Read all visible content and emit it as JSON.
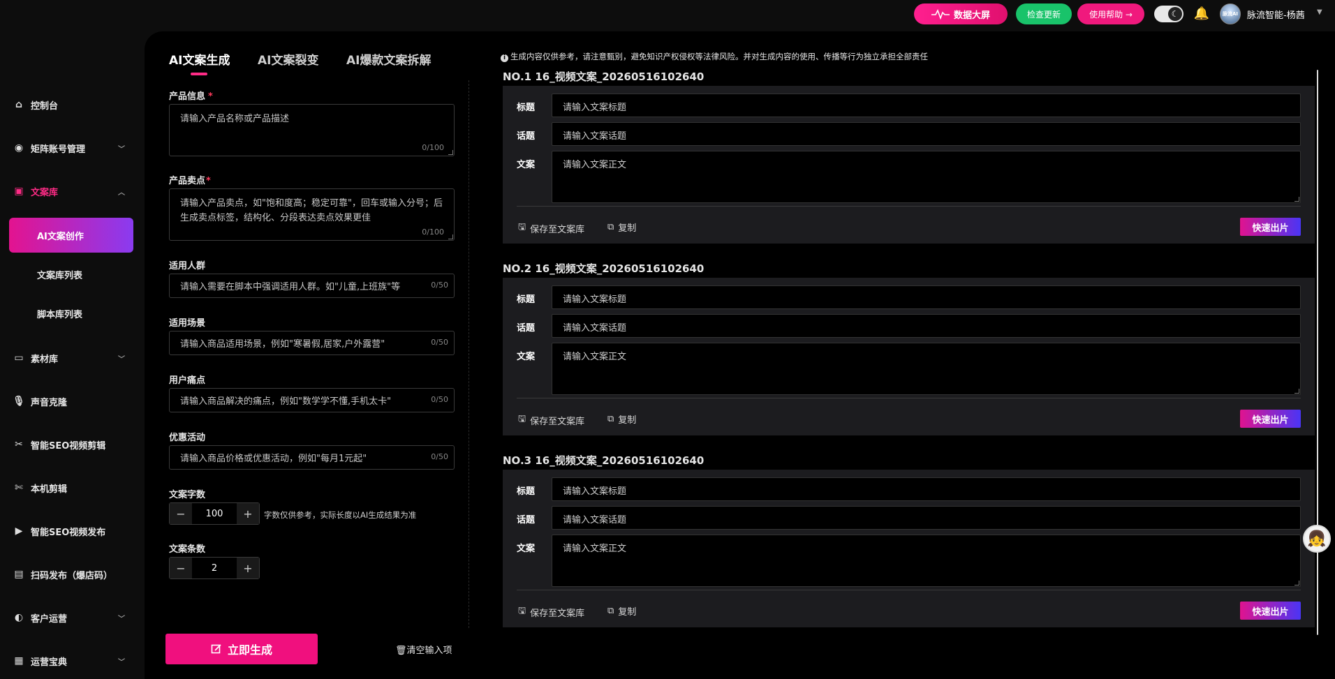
{
  "topbar": {
    "data_screen": "数据大屏",
    "check_update": "检查更新",
    "help": "使用帮助 →",
    "username": "脉流智能-杨茜",
    "avatar_text": "脉流AI"
  },
  "sidebar": {
    "items": [
      {
        "label": "控制台",
        "icon": "home-icon"
      },
      {
        "label": "矩阵账号管理",
        "icon": "account-icon"
      },
      {
        "label": "文案库",
        "icon": "library-icon"
      },
      {
        "label": "素材库",
        "icon": "folder-icon"
      },
      {
        "label": "声音克隆",
        "icon": "mic-icon"
      },
      {
        "label": "智能SEO视频剪辑",
        "icon": "scissors-icon"
      },
      {
        "label": "本机剪辑",
        "icon": "scissors-icon"
      },
      {
        "label": "智能SEO视频发布",
        "icon": "video-icon"
      },
      {
        "label": "扫码发布（爆店码）",
        "icon": "qrcode-icon"
      },
      {
        "label": "客户运营",
        "icon": "customer-icon"
      },
      {
        "label": "运营宝典",
        "icon": "book-icon"
      }
    ],
    "sub_items": [
      "AI文案创作",
      "文案库列表",
      "脚本库列表"
    ]
  },
  "tabs": [
    "AI文案生成",
    "AI文案裂变",
    "AI爆款文案拆解"
  ],
  "form": {
    "product_info": {
      "label": "产品信息",
      "placeholder": "请输入产品名称或产品描述",
      "count": "0/100"
    },
    "selling_points": {
      "label": "产品卖点",
      "placeholder": "请输入产品卖点，如\"饱和度高；稳定可靠\"，回车或输入分号；后生成卖点标签，结构化、分段表达卖点效果更佳",
      "count": "0/100"
    },
    "audience": {
      "label": "适用人群",
      "placeholder": "请输入需要在脚本中强调适用人群。如\"儿童,上班族\"等",
      "count": "0/50"
    },
    "scene": {
      "label": "适用场景",
      "placeholder": "请输入商品适用场景，例如\"寒暑假,居家,户外露营\"",
      "count": "0/50"
    },
    "pain_points": {
      "label": "用户痛点",
      "placeholder": "请输入商品解决的痛点，例如\"数学学不懂,手机太卡\"",
      "count": "0/50"
    },
    "promotion": {
      "label": "优惠活动",
      "placeholder": "请输入商品价格或优惠活动，例如\"每月1元起\"",
      "count": "0/50"
    },
    "word_count": {
      "label": "文案字数",
      "value": "100",
      "hint": "字数仅供参考，实际长度以AI生成结果为准"
    },
    "copy_count": {
      "label": "文案条数",
      "value": "2"
    },
    "generate": "立即生成",
    "clear": "清空输入项"
  },
  "notice": "生成内容仅供参考，请注意甄别，避免知识产权侵权等法律风险。并对生成内容的使用、传播等行为独立承担全部责任",
  "results": {
    "labels": {
      "title": "标题",
      "topic": "话题",
      "body": "文案"
    },
    "placeholders": {
      "title": "请输入文案标题",
      "topic": "请输入文案话题",
      "body": "请输入文案正文"
    },
    "actions": {
      "save": "保存至文案库",
      "copy": "复制",
      "quick": "快速出片"
    },
    "cards": [
      {
        "heading": "NO.1 16_视频文案_20260516102640"
      },
      {
        "heading": "NO.2 16_视频文案_20260516102640"
      },
      {
        "heading": "NO.3 16_视频文案_20260516102640"
      }
    ]
  }
}
